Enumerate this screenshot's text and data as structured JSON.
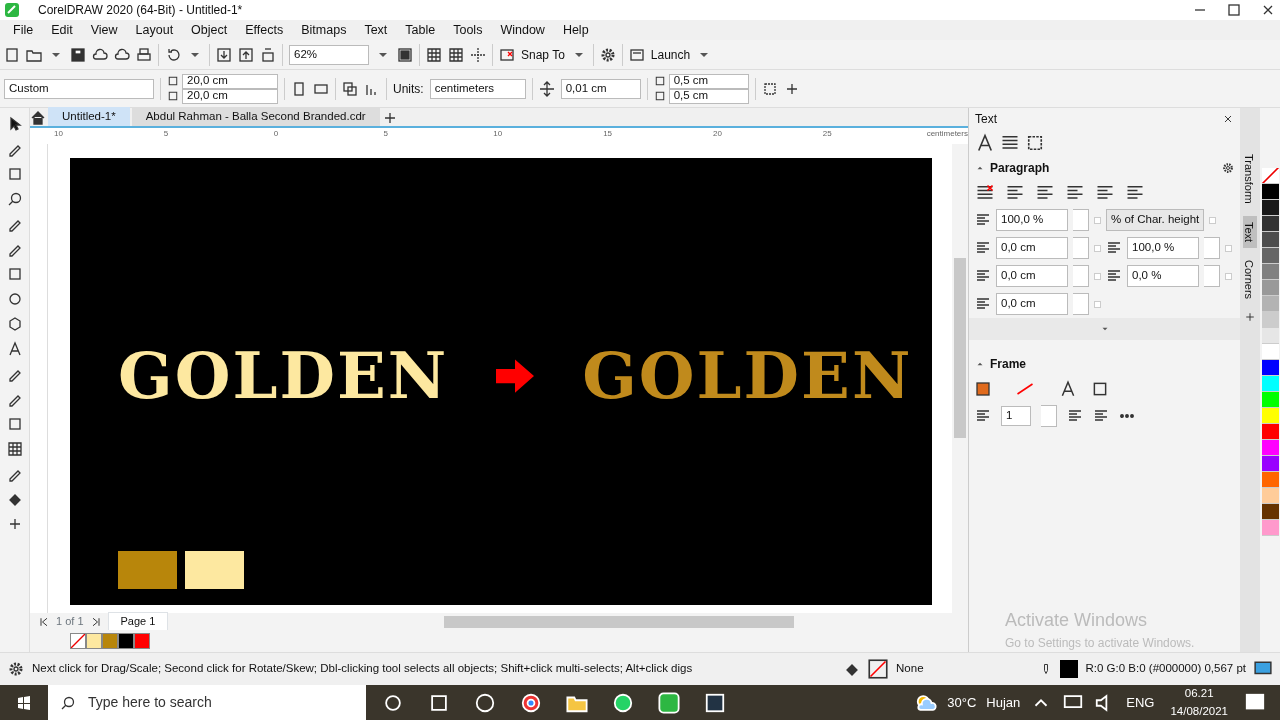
{
  "window": {
    "title": "CorelDRAW 2020 (64-Bit) - Untitled-1*"
  },
  "menu": [
    "File",
    "Edit",
    "View",
    "Layout",
    "Object",
    "Effects",
    "Bitmaps",
    "Text",
    "Table",
    "Tools",
    "Window",
    "Help"
  ],
  "toolbar": {
    "zoom": "62%",
    "snap": "Snap To",
    "launch": "Launch"
  },
  "property_bar": {
    "page_size": "Custom",
    "width": "20,0 cm",
    "height": "20,0 cm",
    "units_label": "Units:",
    "units": "centimeters",
    "nudge": "0,01 cm",
    "dup_x": "0,5 cm",
    "dup_y": "0,5 cm"
  },
  "doc_tabs": [
    {
      "label": "Untitled-1*",
      "selected": true
    },
    {
      "label": "Abdul Rahman - Balla Second Branded.cdr",
      "selected": false
    }
  ],
  "ruler": {
    "labels": [
      "10",
      "5",
      "0",
      "5",
      "10",
      "15",
      "20",
      "25"
    ],
    "unit": "centimeters"
  },
  "canvas": {
    "headings": [
      {
        "text": "GOLDEN",
        "color": "#fde8a0"
      },
      {
        "text": "GOLDEN",
        "color": "#c08a1c"
      }
    ],
    "swatches": [
      {
        "color": "#b8860b"
      },
      {
        "color": "#fde8a0"
      }
    ]
  },
  "page_nav": {
    "count": "1 of 1",
    "page": "Page 1"
  },
  "document_palette": [
    {
      "kind": "none"
    },
    {
      "color": "#fde8a0"
    },
    {
      "color": "#b8860b"
    },
    {
      "color": "#000000"
    },
    {
      "color": "#ff0000"
    }
  ],
  "docker": {
    "title": "Text",
    "paragraph": "Paragraph",
    "line_spacing": "100,0 %",
    "spacing_unit": "% of Char. height",
    "left_indent": "0,0 cm",
    "char_spacing": "100,0 %",
    "first_indent": "0,0 cm",
    "word_spacing": "0,0 %",
    "right_indent": "0,0 cm",
    "frame": "Frame",
    "columns": "1"
  },
  "side_tabs": [
    {
      "label": "Transform",
      "selected": false
    },
    {
      "label": "Text",
      "selected": true
    },
    {
      "label": "Corners",
      "selected": false
    }
  ],
  "palette": [
    {
      "kind": "none"
    },
    {
      "color": "#000000"
    },
    {
      "color": "#1a1a1a"
    },
    {
      "color": "#333333"
    },
    {
      "color": "#4d4d4d"
    },
    {
      "color": "#666666"
    },
    {
      "color": "#808080"
    },
    {
      "color": "#999999"
    },
    {
      "color": "#b3b3b3"
    },
    {
      "color": "#cccccc"
    },
    {
      "color": "#e6e6e6"
    },
    {
      "color": "#ffffff"
    },
    {
      "color": "#0000ff"
    },
    {
      "color": "#00ffff"
    },
    {
      "color": "#00ff00"
    },
    {
      "color": "#ffff00"
    },
    {
      "color": "#ff0000"
    },
    {
      "color": "#ff00ff"
    },
    {
      "color": "#9900ff"
    },
    {
      "color": "#ff6600"
    },
    {
      "color": "#ffcc99"
    },
    {
      "color": "#663300"
    },
    {
      "color": "#ff99cc"
    }
  ],
  "activation": {
    "title": "Activate Windows",
    "hint": "Go to Settings to activate Windows."
  },
  "status": {
    "hint": "Next click for Drag/Scale; Second click for Rotate/Skew; Dbl-clicking tool selects all objects; Shift+click multi-selects; Alt+click digs",
    "fill": "None",
    "outline": "R:0 G:0 B:0 (#000000)  0,567 pt"
  },
  "taskbar": {
    "search": "Type here to search",
    "temperature": "30°C",
    "weather": "Hujan",
    "language": "ENG",
    "time": "06.21",
    "date": "14/08/2021"
  }
}
